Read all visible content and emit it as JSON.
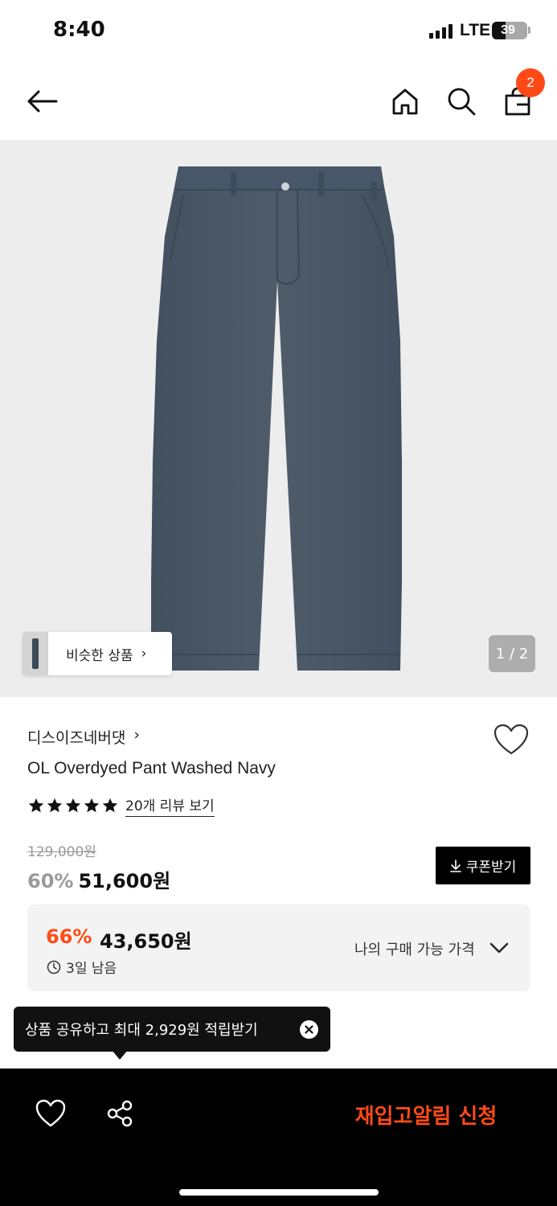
{
  "status_bar": {
    "time": "8:40",
    "network": "LTE",
    "battery": "39",
    "battery_level": 0.39
  },
  "nav": {
    "back_icon": "arrow-left-icon",
    "home_icon": "home-icon",
    "search_icon": "search-icon",
    "cart_icon": "shopping-bag-icon",
    "cart_count": "2"
  },
  "gallery": {
    "similar_label": "비슷한 상품",
    "page_counter": "1 / 2"
  },
  "product": {
    "brand": "디스이즈네버댓",
    "name": "OL Overdyed Pant Washed Navy",
    "rating_stars": 5,
    "review_link": "20개 리뷰 보기",
    "original_price": "129,000원",
    "discount_pct": "60%",
    "sale_price": "51,600원",
    "coupon_label": "쿠폰받기"
  },
  "my_price": {
    "discount_pct": "66%",
    "price": "43,650원",
    "remaining": "3일 남음",
    "label": "나의 구매 가능 가격"
  },
  "tooltip": {
    "text": "상품 공유하고 최대 2,929원 적립받기"
  },
  "bottom_bar": {
    "restock_label": "재입고알림 신청"
  },
  "colors": {
    "accent": "#ff4a17",
    "denim": "#4a5866"
  }
}
